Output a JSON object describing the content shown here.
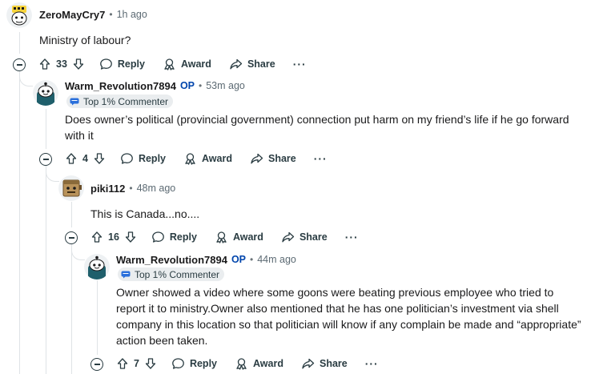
{
  "colors": {
    "op": "#0045ac",
    "thread_line": "#dfe3e6",
    "meta": "#5c6a73",
    "flair_bg": "#eaedef"
  },
  "comments": [
    {
      "username": "ZeroMayCry7",
      "time": "1h ago",
      "body": "Ministry of labour?",
      "votes": "33",
      "reply_label": "Reply",
      "award_label": "Award",
      "share_label": "Share",
      "avatar_icon": "yellow-hat-avatar-icon"
    },
    {
      "username": "Warm_Revolution7894",
      "op_badge": "OP",
      "time": "53m ago",
      "flair": "Top 1% Commenter",
      "body": "Does owner’s political (provincial government) connection put harm on my friend’s life if he go forward with it",
      "votes": "4",
      "reply_label": "Reply",
      "award_label": "Award",
      "share_label": "Share",
      "avatar_icon": "snoo-avatar-icon"
    },
    {
      "username": "piki112",
      "time": "48m ago",
      "body": "This is Canada...no....",
      "votes": "16",
      "reply_label": "Reply",
      "award_label": "Award",
      "share_label": "Share",
      "avatar_icon": "box-head-avatar-icon"
    },
    {
      "username": "Warm_Revolution7894",
      "op_badge": "OP",
      "time": "44m ago",
      "flair": "Top 1% Commenter",
      "body": "Owner showed a video where some goons were beating previous employee who tried to report it to ministry.Owner also mentioned that he has one politician’s investment via shell company in this location so that politician will know if any complain be made and “appropriate” action been taken.",
      "votes": "7",
      "reply_label": "Reply",
      "award_label": "Award",
      "share_label": "Share",
      "avatar_icon": "snoo-avatar-icon"
    }
  ]
}
